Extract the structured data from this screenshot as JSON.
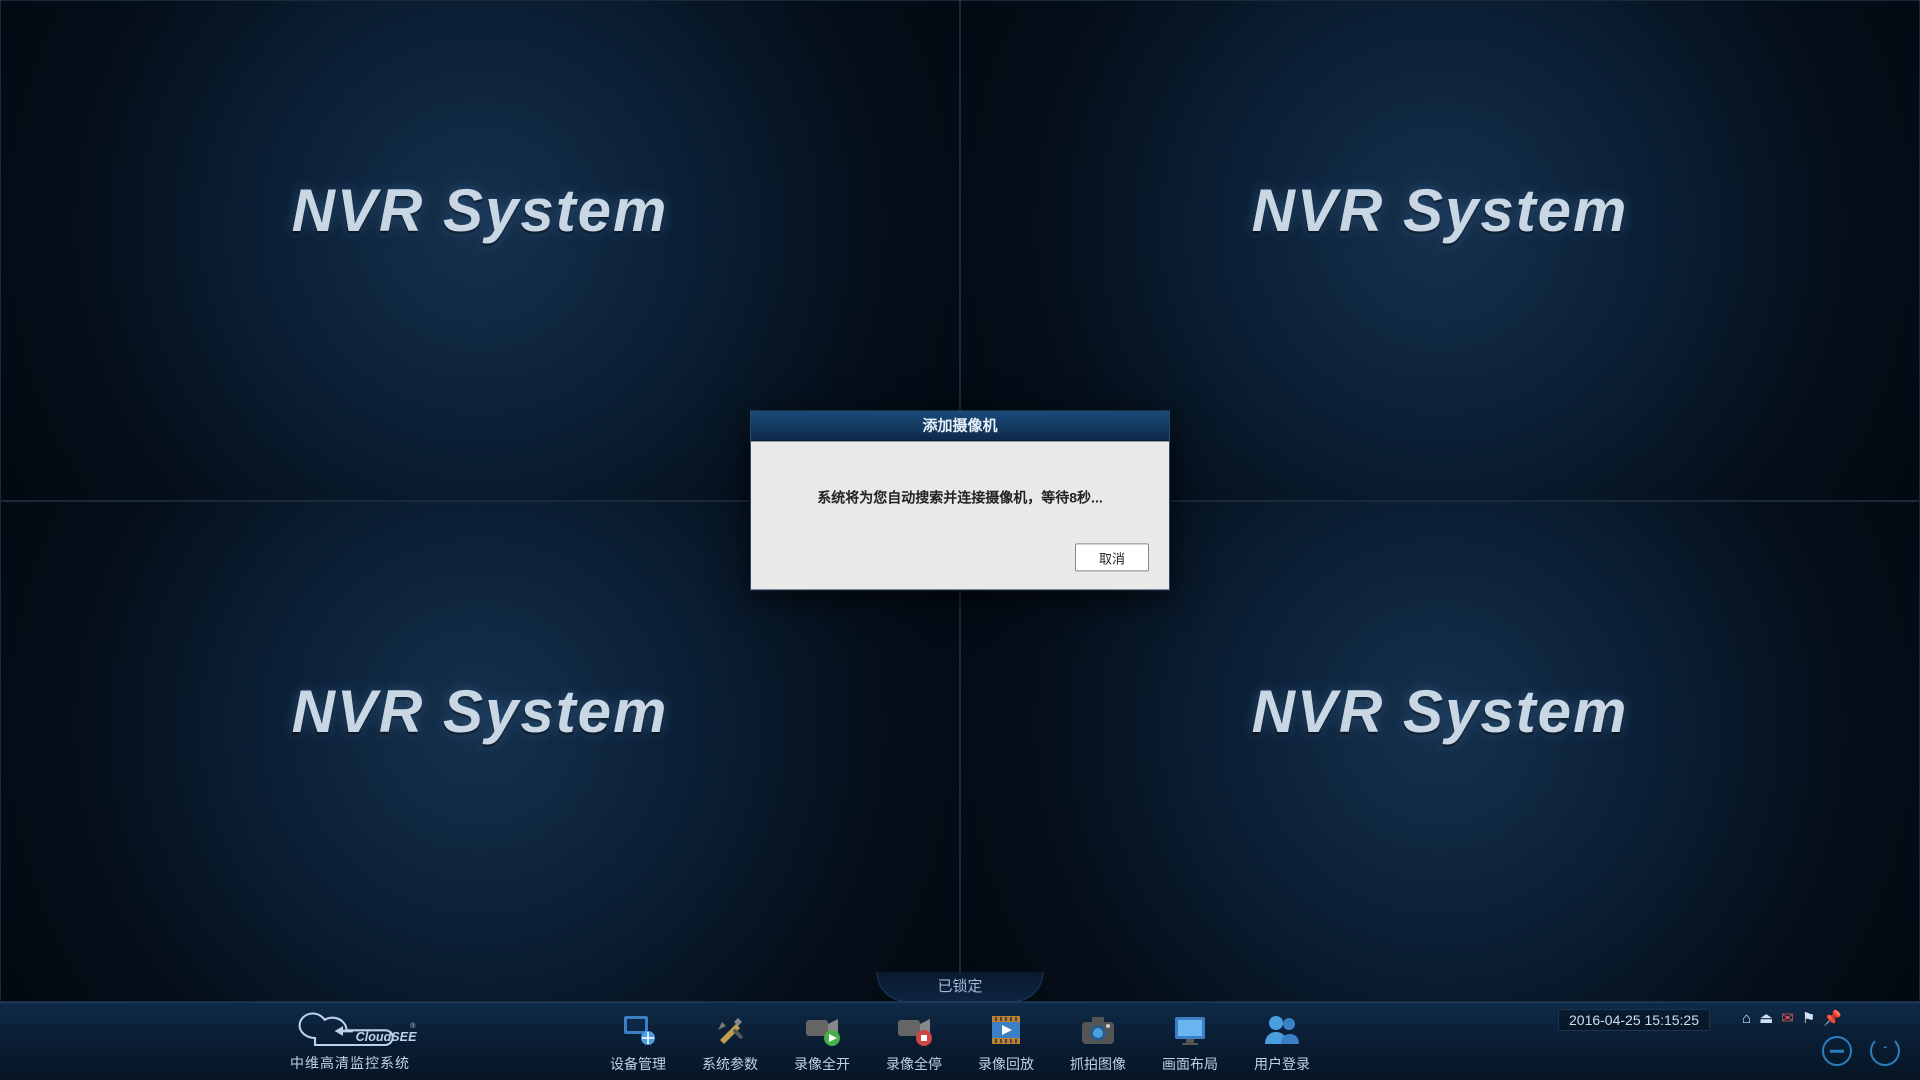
{
  "tile_label": "NVR System",
  "lock_label": "已锁定",
  "logo_caption": "中维高清监控系统",
  "logo_brand": "CloudSEE",
  "toolbar": {
    "device": "设备管理",
    "params": "系统参数",
    "rec_on": "录像全开",
    "rec_off": "录像全停",
    "playback": "录像回放",
    "snapshot": "抓拍图像",
    "layout": "画面布局",
    "login": "用户登录"
  },
  "datetime": "2016-04-25 15:15:25",
  "dialog": {
    "title": "添加摄像机",
    "message": "系统将为您自动搜索并连接摄像机，等待8秒...",
    "cancel": "取消"
  }
}
